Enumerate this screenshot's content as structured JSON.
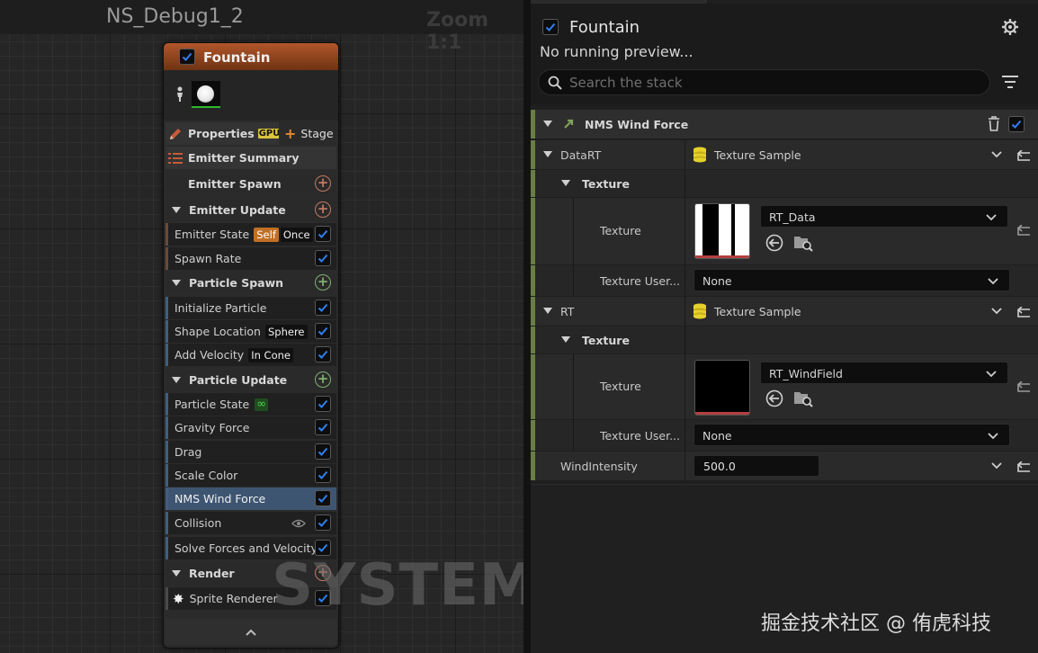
{
  "graph": {
    "title": "NS_Debug1_2",
    "zoom_label": "Zoom 1:1",
    "watermark": "SYSTEM"
  },
  "node": {
    "title": "Fountain",
    "properties_label": "Properties",
    "gpu_badge": "GPU",
    "stage_label": "Stage",
    "emitter_summary": "Emitter Summary",
    "emitter_spawn": "Emitter Spawn",
    "emitter_update": "Emitter Update",
    "emitter_state": {
      "label": "Emitter State",
      "self": "Self",
      "once": "Once"
    },
    "spawn_rate": "Spawn Rate",
    "particle_spawn": "Particle Spawn",
    "initialize_particle": "Initialize Particle",
    "shape_location": {
      "label": "Shape Location",
      "value": "Sphere"
    },
    "add_velocity": {
      "label": "Add Velocity",
      "value": "In Cone"
    },
    "particle_update": "Particle Update",
    "particle_state": "Particle State",
    "gravity_force": "Gravity Force",
    "drag": "Drag",
    "scale_color": "Scale Color",
    "nms_wind_force": "NMS Wind Force",
    "collision": "Collision",
    "solve_forces": "Solve Forces and Velocity",
    "render": "Render",
    "sprite_renderer": "Sprite Renderer"
  },
  "panel": {
    "title": "Fountain",
    "status": "No running preview...",
    "search_placeholder": "Search the stack",
    "module_title": "NMS Wind Force",
    "datart": {
      "label": "DataRT",
      "type": "Texture Sample",
      "texture_group": "Texture",
      "texture_label": "Texture",
      "texture_value": "RT_Data",
      "texture_user_label": "Texture User...",
      "texture_user_value": "None"
    },
    "rt": {
      "label": "RT",
      "type": "Texture Sample",
      "texture_group": "Texture",
      "texture_label": "Texture",
      "texture_value": "RT_WindField",
      "texture_user_label": "Texture User...",
      "texture_user_value": "None"
    },
    "wind_intensity": {
      "label": "WindIntensity",
      "value": "500.0"
    }
  },
  "footer_watermark": "掘金技术社区 @ 侑虎科技",
  "colors": {
    "accent_blue": "#2f6fd6",
    "node_header": "#b2562a",
    "selection": "#3e5572",
    "module_bar": "#6b7d46"
  }
}
